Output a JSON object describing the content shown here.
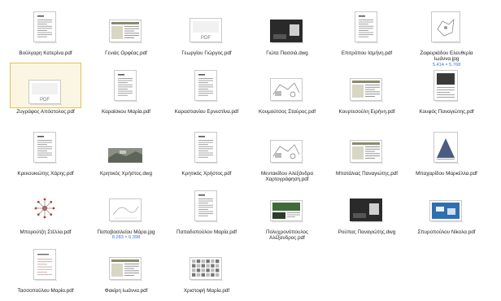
{
  "files": [
    {
      "name": "Βούλγαρη Κατερίνα.pdf",
      "kind": "doc"
    },
    {
      "name": "Γενιάς Ορφέας.pdf",
      "kind": "table"
    },
    {
      "name": "Γεωργίου Γιώργος.pdf",
      "kind": "pdf"
    },
    {
      "name": "Γιώτα Πασσιά.dwg",
      "kind": "dark"
    },
    {
      "name": "Επιτρόπου Ισμήνη.pdf",
      "kind": "doc"
    },
    {
      "name": "Ζαφειριάδου Ελευθερία Ιωάννα.jpg",
      "kind": "map",
      "dims": "5.414 × 5.768"
    },
    {
      "name": "Ζυγράφος Απόστολος.pdf",
      "kind": "pdf",
      "selected": true
    },
    {
      "name": "Καραϊσκου Μαρία.pdf",
      "kind": "doc"
    },
    {
      "name": "Καραστιανίου Ερνεστίνα.pdf",
      "kind": "doc"
    },
    {
      "name": "Κουμούτσος Σταύρος.pdf",
      "kind": "plan"
    },
    {
      "name": "Κουρτεσούλη Ειρήνη.pdf",
      "kind": "table"
    },
    {
      "name": "Κουφός Παναγιώτης.pdf",
      "kind": "photodoc"
    },
    {
      "name": "Κρεκουκιώτης Χάρης.pdf",
      "kind": "doc"
    },
    {
      "name": "Κρητικός Χρήστος.dwg",
      "kind": "aerial"
    },
    {
      "name": "Κρητικός Χρήστος.pdf",
      "kind": "doc"
    },
    {
      "name": "Μεντακίδου Αλεξάνδρα Χαρτογράφηση.pdf",
      "kind": "plan"
    },
    {
      "name": "Μπατάλιας Παναγιώτης.pdf",
      "kind": "table"
    },
    {
      "name": "Μπαχαρίδου Μαρκέλλα.pdf",
      "kind": "pyramid"
    },
    {
      "name": "Μπορούτζη Στέλλα.pdf",
      "kind": "burst"
    },
    {
      "name": "Παπαβασιλείου Μάρα.jpg",
      "kind": "sketch",
      "dims": "8.283 × 6.398"
    },
    {
      "name": "Παπαδοπούλου Μαρία.pdf",
      "kind": "doc"
    },
    {
      "name": "Πολυχρονόπουλος Αλέξανδρος.pdf",
      "kind": "greenmap"
    },
    {
      "name": "Ρούπας Παναγιώτης.dwg",
      "kind": "dark"
    },
    {
      "name": "Σπυροπούλου Νίκολα.pdf",
      "kind": "bluemap"
    },
    {
      "name": "Τασσοπούλου Μαρία.pdf",
      "kind": "lined"
    },
    {
      "name": "Φακίρη Ιωάννα.pdf",
      "kind": "table"
    },
    {
      "name": "Χριστοφή Μαρία.pdf",
      "kind": "gridpat"
    }
  ]
}
